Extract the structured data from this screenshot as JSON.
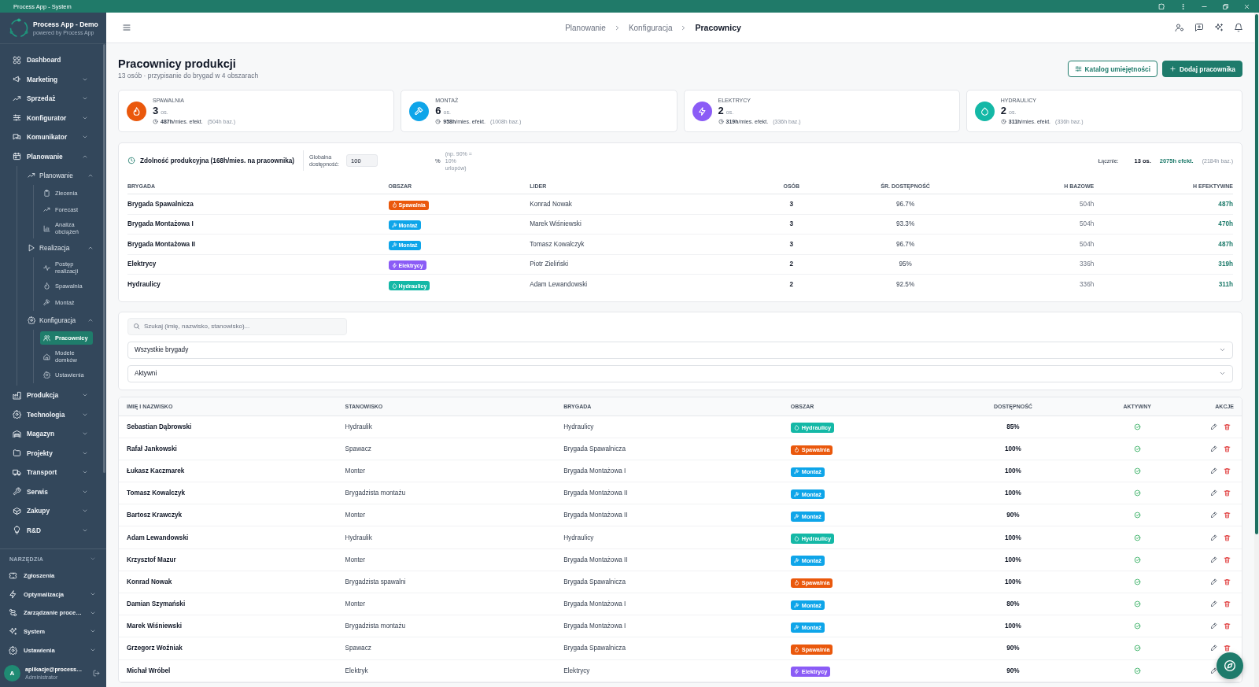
{
  "titlebar": {
    "title": "Process App - System"
  },
  "sidebar": {
    "brand": {
      "name": "Process App - Demo",
      "tagline": "powered by Process App"
    },
    "nav": [
      {
        "label": "Dashboard",
        "kind": "link"
      },
      {
        "label": "Marketing",
        "kind": "group",
        "expanded": false
      },
      {
        "label": "Sprzedaż",
        "kind": "group",
        "expanded": false
      },
      {
        "label": "Konfigurator",
        "kind": "group",
        "expanded": false
      },
      {
        "label": "Komunikator",
        "kind": "group",
        "expanded": false
      },
      {
        "label": "Planowanie",
        "kind": "group",
        "expanded": true,
        "children": [
          {
            "label": "Planowanie",
            "expanded": true,
            "children": [
              {
                "label": "Zlecenia",
                "selected": false
              },
              {
                "label": "Forecast",
                "selected": false
              },
              {
                "label": "Analiza obciążeń",
                "selected": false
              }
            ]
          },
          {
            "label": "Realizacja",
            "expanded": true,
            "children": [
              {
                "label": "Postęp realizacji",
                "selected": false
              },
              {
                "label": "Spawalnia",
                "selected": false
              },
              {
                "label": "Montaż",
                "selected": false
              }
            ]
          },
          {
            "label": "Konfiguracja",
            "expanded": true,
            "children": [
              {
                "label": "Pracownicy",
                "selected": true
              },
              {
                "label": "Modele domków",
                "selected": false
              },
              {
                "label": "Ustawienia",
                "selected": false
              }
            ]
          }
        ]
      },
      {
        "label": "Produkcja",
        "kind": "group",
        "expanded": false
      },
      {
        "label": "Technologia",
        "kind": "group",
        "expanded": false
      },
      {
        "label": "Magazyn",
        "kind": "group",
        "expanded": false
      },
      {
        "label": "Projekty",
        "kind": "group",
        "expanded": false
      },
      {
        "label": "Transport",
        "kind": "group",
        "expanded": false
      },
      {
        "label": "Serwis",
        "kind": "group",
        "expanded": false
      },
      {
        "label": "Zakupy",
        "kind": "group",
        "expanded": false
      },
      {
        "label": "R&D",
        "kind": "group",
        "expanded": false
      }
    ],
    "tools": {
      "heading": "NARZĘDZIA",
      "items": [
        {
          "label": "Zgłoszenia",
          "kind": "link"
        },
        {
          "label": "Optymalizacja",
          "kind": "group",
          "expanded": false
        },
        {
          "label": "Zarządzanie proce…",
          "kind": "group",
          "expanded": false
        },
        {
          "label": "System",
          "kind": "group",
          "expanded": false
        },
        {
          "label": "Ustawienia",
          "kind": "group",
          "expanded": false
        }
      ]
    },
    "user": {
      "initial": "A",
      "email": "aplikacje@process…",
      "role": "Administrator"
    }
  },
  "header": {
    "breadcrumb": [
      {
        "label": "Planowanie",
        "selected": false
      },
      {
        "label": "Konfiguracja",
        "selected": false
      },
      {
        "label": "Pracownicy",
        "selected": true
      }
    ]
  },
  "page": {
    "title": "Pracownicy produkcji",
    "subtitle": "13 osób · przypisanie do brygad w 4 obszarach",
    "buttons": [
      {
        "label": "Katalog umiejętności",
        "kind": "secondary"
      },
      {
        "label": "Dodaj pracownika",
        "kind": "primary"
      }
    ]
  },
  "stats": [
    {
      "label": "SPAWALNIA",
      "kind": "welding",
      "color": "#ea580c",
      "count": "3",
      "unit": "os.",
      "effective": "487h",
      "effective_label": "/mies. efekt.",
      "base": "(504h baz.)"
    },
    {
      "label": "MONTAŻ",
      "kind": "assembly",
      "color": "#0ea5e9",
      "count": "6",
      "unit": "os.",
      "effective": "958h",
      "effective_label": "/mies. efekt.",
      "base": "(1008h baz.)"
    },
    {
      "label": "ELEKTRYCY",
      "kind": "electric",
      "color": "#8b5cf6",
      "count": "2",
      "unit": "os.",
      "effective": "319h",
      "effective_label": "/mies. efekt.",
      "base": "(336h baz.)"
    },
    {
      "label": "HYDRAULICY",
      "kind": "hydraulic",
      "color": "#14b8a6",
      "count": "2",
      "unit": "os.",
      "effective": "311h",
      "effective_label": "/mies. efekt.",
      "base": "(336h baz.)"
    }
  ],
  "capacity": {
    "title": "Zdolność produkcyjna (168h/mies. na pracownika)",
    "availability": {
      "label": "Globalna dostępność:",
      "value": "100",
      "unit": "%",
      "hint": "(np. 90% = 10% urlopów)"
    },
    "totals": {
      "label": "Łącznie:",
      "people": "13 os.",
      "effective": "2075h efekt.",
      "base": "(2184h baz.)"
    },
    "columns": [
      "BRYGADA",
      "OBSZAR",
      "LIDER",
      "OSÓB",
      "ŚR. DOSTĘPNOŚĆ",
      "H BAZOWE",
      "H EFEKTYWNE"
    ],
    "rows": [
      {
        "brigade": "Brygada Spawalnicza",
        "area": {
          "label": "Spawalnia",
          "kind": "welding",
          "color": "#ea580c"
        },
        "leader": "Konrad Nowak",
        "people": "3",
        "availability": "96.7%",
        "base_hours": "504h",
        "effective_hours": "487h"
      },
      {
        "brigade": "Brygada Montażowa I",
        "area": {
          "label": "Montaż",
          "kind": "assembly",
          "color": "#0ea5e9"
        },
        "leader": "Marek Wiśniewski",
        "people": "3",
        "availability": "93.3%",
        "base_hours": "504h",
        "effective_hours": "470h"
      },
      {
        "brigade": "Brygada Montażowa II",
        "area": {
          "label": "Montaż",
          "kind": "assembly",
          "color": "#0ea5e9"
        },
        "leader": "Tomasz Kowalczyk",
        "people": "3",
        "availability": "96.7%",
        "base_hours": "504h",
        "effective_hours": "487h"
      },
      {
        "brigade": "Elektrycy",
        "area": {
          "label": "Elektrycy",
          "kind": "electric",
          "color": "#8b5cf6"
        },
        "leader": "Piotr Zieliński",
        "people": "2",
        "availability": "95%",
        "base_hours": "336h",
        "effective_hours": "319h"
      },
      {
        "brigade": "Hydraulicy",
        "area": {
          "label": "Hydraulicy",
          "kind": "hydraulic",
          "color": "#14b8a6"
        },
        "leader": "Adam Lewandowski",
        "people": "2",
        "availability": "92.5%",
        "base_hours": "336h",
        "effective_hours": "311h"
      }
    ]
  },
  "filters": {
    "search": {
      "placeholder": "Szukaj (imię, nazwisko, stanowisko)..."
    },
    "selects": [
      {
        "value": "Wszystkie brygady"
      },
      {
        "value": "Aktywni"
      }
    ]
  },
  "workers": {
    "columns": [
      "IMIĘ I NAZWISKO",
      "STANOWISKO",
      "BRYGADA",
      "OBSZAR",
      "DOSTĘPNOŚĆ",
      "AKTYWNY",
      "AKCJE"
    ],
    "rows": [
      {
        "name": "Sebastian Dąbrowski",
        "position": "Hydraulik",
        "brigade": "Hydraulicy",
        "area": {
          "label": "Hydraulicy",
          "kind": "hydraulic",
          "color": "#14b8a6"
        },
        "availability": "85%",
        "active": true
      },
      {
        "name": "Rafał Jankowski",
        "position": "Spawacz",
        "brigade": "Brygada Spawalnicza",
        "area": {
          "label": "Spawalnia",
          "kind": "welding",
          "color": "#ea580c"
        },
        "availability": "100%",
        "active": true
      },
      {
        "name": "Łukasz Kaczmarek",
        "position": "Monter",
        "brigade": "Brygada Montażowa I",
        "area": {
          "label": "Montaż",
          "kind": "assembly",
          "color": "#0ea5e9"
        },
        "availability": "100%",
        "active": true
      },
      {
        "name": "Tomasz Kowalczyk",
        "position": "Brygadzista montażu",
        "brigade": "Brygada Montażowa II",
        "area": {
          "label": "Montaż",
          "kind": "assembly",
          "color": "#0ea5e9"
        },
        "availability": "100%",
        "active": true
      },
      {
        "name": "Bartosz Krawczyk",
        "position": "Monter",
        "brigade": "Brygada Montażowa II",
        "area": {
          "label": "Montaż",
          "kind": "assembly",
          "color": "#0ea5e9"
        },
        "availability": "90%",
        "active": true
      },
      {
        "name": "Adam Lewandowski",
        "position": "Hydraulik",
        "brigade": "Hydraulicy",
        "area": {
          "label": "Hydraulicy",
          "kind": "hydraulic",
          "color": "#14b8a6"
        },
        "availability": "100%",
        "active": true
      },
      {
        "name": "Krzysztof Mazur",
        "position": "Monter",
        "brigade": "Brygada Montażowa II",
        "area": {
          "label": "Montaż",
          "kind": "assembly",
          "color": "#0ea5e9"
        },
        "availability": "100%",
        "active": true
      },
      {
        "name": "Konrad Nowak",
        "position": "Brygadzista spawalni",
        "brigade": "Brygada Spawalnicza",
        "area": {
          "label": "Spawalnia",
          "kind": "welding",
          "color": "#ea580c"
        },
        "availability": "100%",
        "active": true
      },
      {
        "name": "Damian Szymański",
        "position": "Monter",
        "brigade": "Brygada Montażowa I",
        "area": {
          "label": "Montaż",
          "kind": "assembly",
          "color": "#0ea5e9"
        },
        "availability": "80%",
        "active": true
      },
      {
        "name": "Marek Wiśniewski",
        "position": "Brygadzista montażu",
        "brigade": "Brygada Montażowa I",
        "area": {
          "label": "Montaż",
          "kind": "assembly",
          "color": "#0ea5e9"
        },
        "availability": "100%",
        "active": true
      },
      {
        "name": "Grzegorz Woźniak",
        "position": "Spawacz",
        "brigade": "Brygada Spawalnicza",
        "area": {
          "label": "Spawalnia",
          "kind": "welding",
          "color": "#ea580c"
        },
        "availability": "90%",
        "active": true
      },
      {
        "name": "Michał Wróbel",
        "position": "Elektryk",
        "brigade": "Elektrycy",
        "area": {
          "label": "Elektrycy",
          "kind": "electric",
          "color": "#8b5cf6"
        },
        "availability": "90%",
        "active": true
      }
    ]
  }
}
